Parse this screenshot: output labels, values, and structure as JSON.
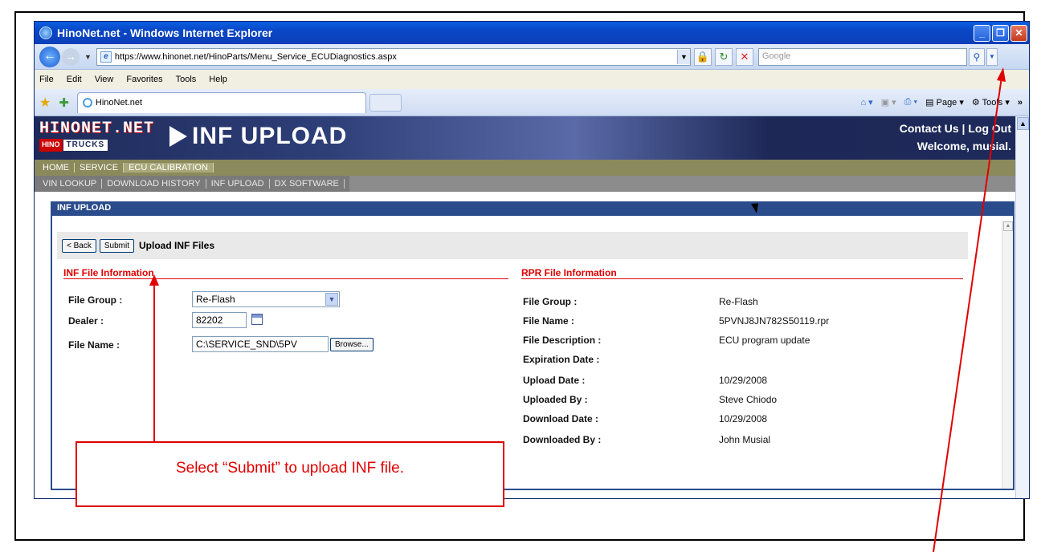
{
  "browser": {
    "window_title": "HinoNet.net - Windows Internet Explorer",
    "url": "https://www.hinonet.net/HinoParts/Menu_Service_ECUDiagnostics.aspx",
    "search_placeholder": "Google",
    "menu": [
      "File",
      "Edit",
      "View",
      "Favorites",
      "Tools",
      "Help"
    ],
    "tab_label": "HinoNet.net",
    "cmd_page": "Page",
    "cmd_tools": "Tools"
  },
  "site": {
    "logo_text": "HINONET.NET",
    "logo_hino": "HINO",
    "logo_trucks": "TRUCKS",
    "banner_title": "INF UPLOAD",
    "header_links": "Contact Us | Log Out",
    "welcome": "Welcome, musial.",
    "nav_primary": [
      "HOME",
      "SERVICE",
      "ECU CALIBRATION"
    ],
    "nav_secondary": [
      "VIN LOOKUP",
      "DOWNLOAD HISTORY",
      "INF UPLOAD",
      "DX SOFTWARE"
    ]
  },
  "panel": {
    "header": "INF UPLOAD",
    "back_label": "< Back",
    "submit_label": "Submit",
    "toolbar_title": "Upload INF Files"
  },
  "inf_info": {
    "title": "INF File Information",
    "file_group_label": "File Group :",
    "file_group_value": "Re-Flash",
    "dealer_label": "Dealer :",
    "dealer_value": "82202",
    "file_name_label": "File Name :",
    "file_name_value": "C:\\SERVICE_SND\\5PV",
    "browse_label": "Browse..."
  },
  "rpr_info": {
    "title": "RPR File Information",
    "rows": [
      {
        "label": "File Group :",
        "value": "Re-Flash"
      },
      {
        "label": "File Name :",
        "value": "5PVNJ8JN782S50119.rpr"
      },
      {
        "label": "File Description :",
        "value": "ECU program update"
      },
      {
        "label": "Expiration Date :",
        "value": ""
      },
      {
        "label": "Upload Date :",
        "value": "10/29/2008"
      },
      {
        "label": "Uploaded By :",
        "value": "Steve Chiodo"
      },
      {
        "label": "Download Date :",
        "value": "10/29/2008"
      },
      {
        "label": "Downloaded By :",
        "value": "John Musial"
      }
    ]
  },
  "annotation": {
    "callout_text": "Select “Submit” to upload INF file.",
    "color": "#e00000"
  }
}
